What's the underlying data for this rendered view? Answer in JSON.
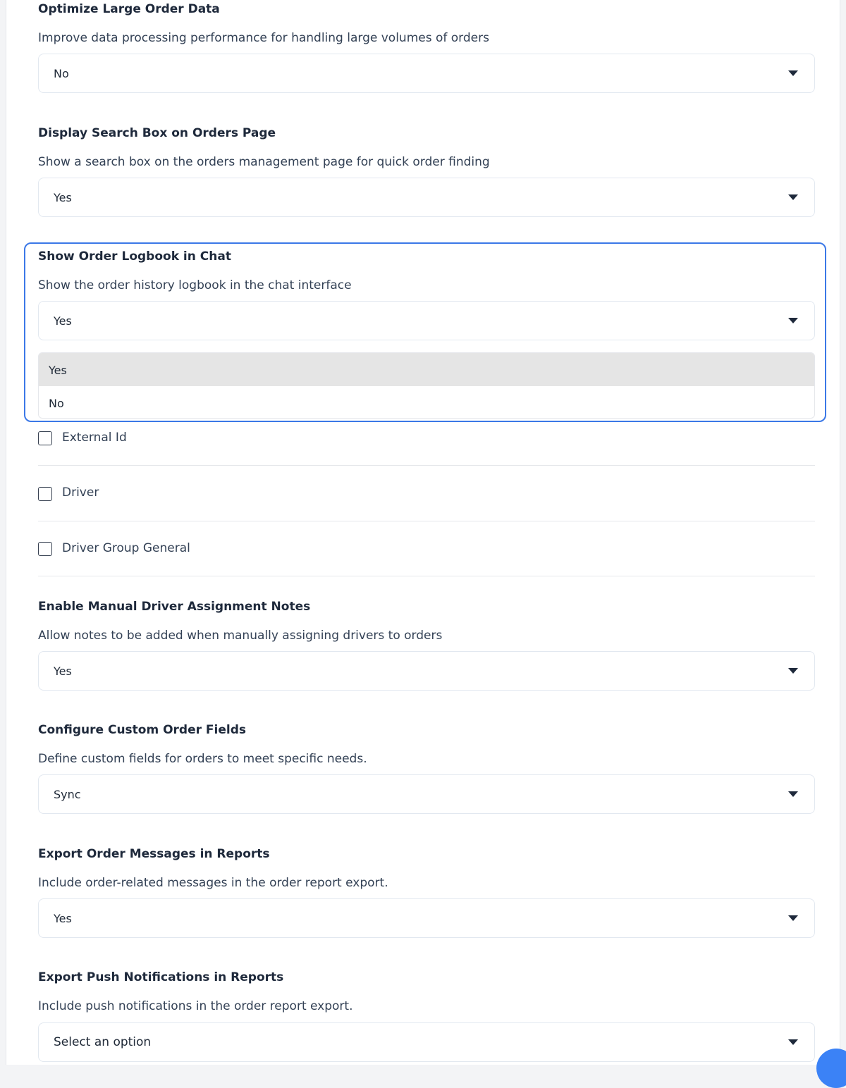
{
  "settings": [
    {
      "title": "Optimize Large Order Data",
      "description": "Improve data processing performance for handling large volumes of orders",
      "value": "No"
    },
    {
      "title": "Display Search Box on Orders Page",
      "description": "Show a search box on the orders management page for quick order finding",
      "value": "Yes"
    },
    {
      "title": "Show Order Logbook in Chat",
      "description": "Show the order history logbook in the chat interface",
      "value": "Yes",
      "options": [
        "Yes",
        "No"
      ],
      "highlighted_option": "Yes"
    },
    {
      "title": "Enable Manual Driver Assignment Notes",
      "description": "Allow notes to be added when manually assigning drivers to orders",
      "value": "Yes"
    },
    {
      "title": "Configure Custom Order Fields",
      "description": "Define custom fields for orders to meet specific needs.",
      "value": "Sync"
    },
    {
      "title": "Export Order Messages in Reports",
      "description": "Include order-related messages in the order report export.",
      "value": "Yes"
    },
    {
      "title": "Export Push Notifications in Reports",
      "description": "Include push notifications in the order report export.",
      "value": "",
      "placeholder": "Select an option"
    }
  ],
  "checkboxes": [
    {
      "label": "External Id",
      "checked": false
    },
    {
      "label": "Driver",
      "checked": false
    },
    {
      "label": "Driver Group General",
      "checked": false
    }
  ],
  "colors": {
    "focus_ring": "#3b78e7",
    "highlight": "#e5e5e5",
    "corner_widget": "#3b82f6"
  }
}
